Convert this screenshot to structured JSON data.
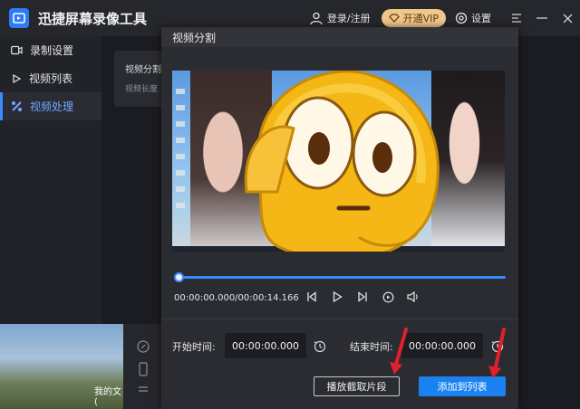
{
  "app": {
    "title": "迅捷屏幕录像工具"
  },
  "header": {
    "login_label": "登录/注册",
    "vip_label": "开通VIP",
    "settings_label": "设置"
  },
  "sidebar": {
    "items": [
      {
        "label": "录制设置",
        "icon": "record-settings-icon"
      },
      {
        "label": "视频列表",
        "icon": "video-list-icon"
      },
      {
        "label": "视频处理",
        "icon": "video-process-icon"
      }
    ]
  },
  "card": {
    "title": "视频分割",
    "subtitle": "视频长度"
  },
  "thumbnail": {
    "caption": "我的文("
  },
  "dialog": {
    "title": "视频分割",
    "timecode": "00:00:00.000/00:00:14.166",
    "playback_progress": 0,
    "start_label": "开始时间:",
    "start_value": "00:00:00.000",
    "end_label": "结束时间:",
    "end_value": "00:00:00.000",
    "play_clip_button": "播放截取片段",
    "add_to_list_button": "添加到列表"
  },
  "colors": {
    "accent": "#3a8bff",
    "primary_button": "#1a82f0",
    "vip": "#f0c68a",
    "annotation_arrow": "#e0202a"
  }
}
